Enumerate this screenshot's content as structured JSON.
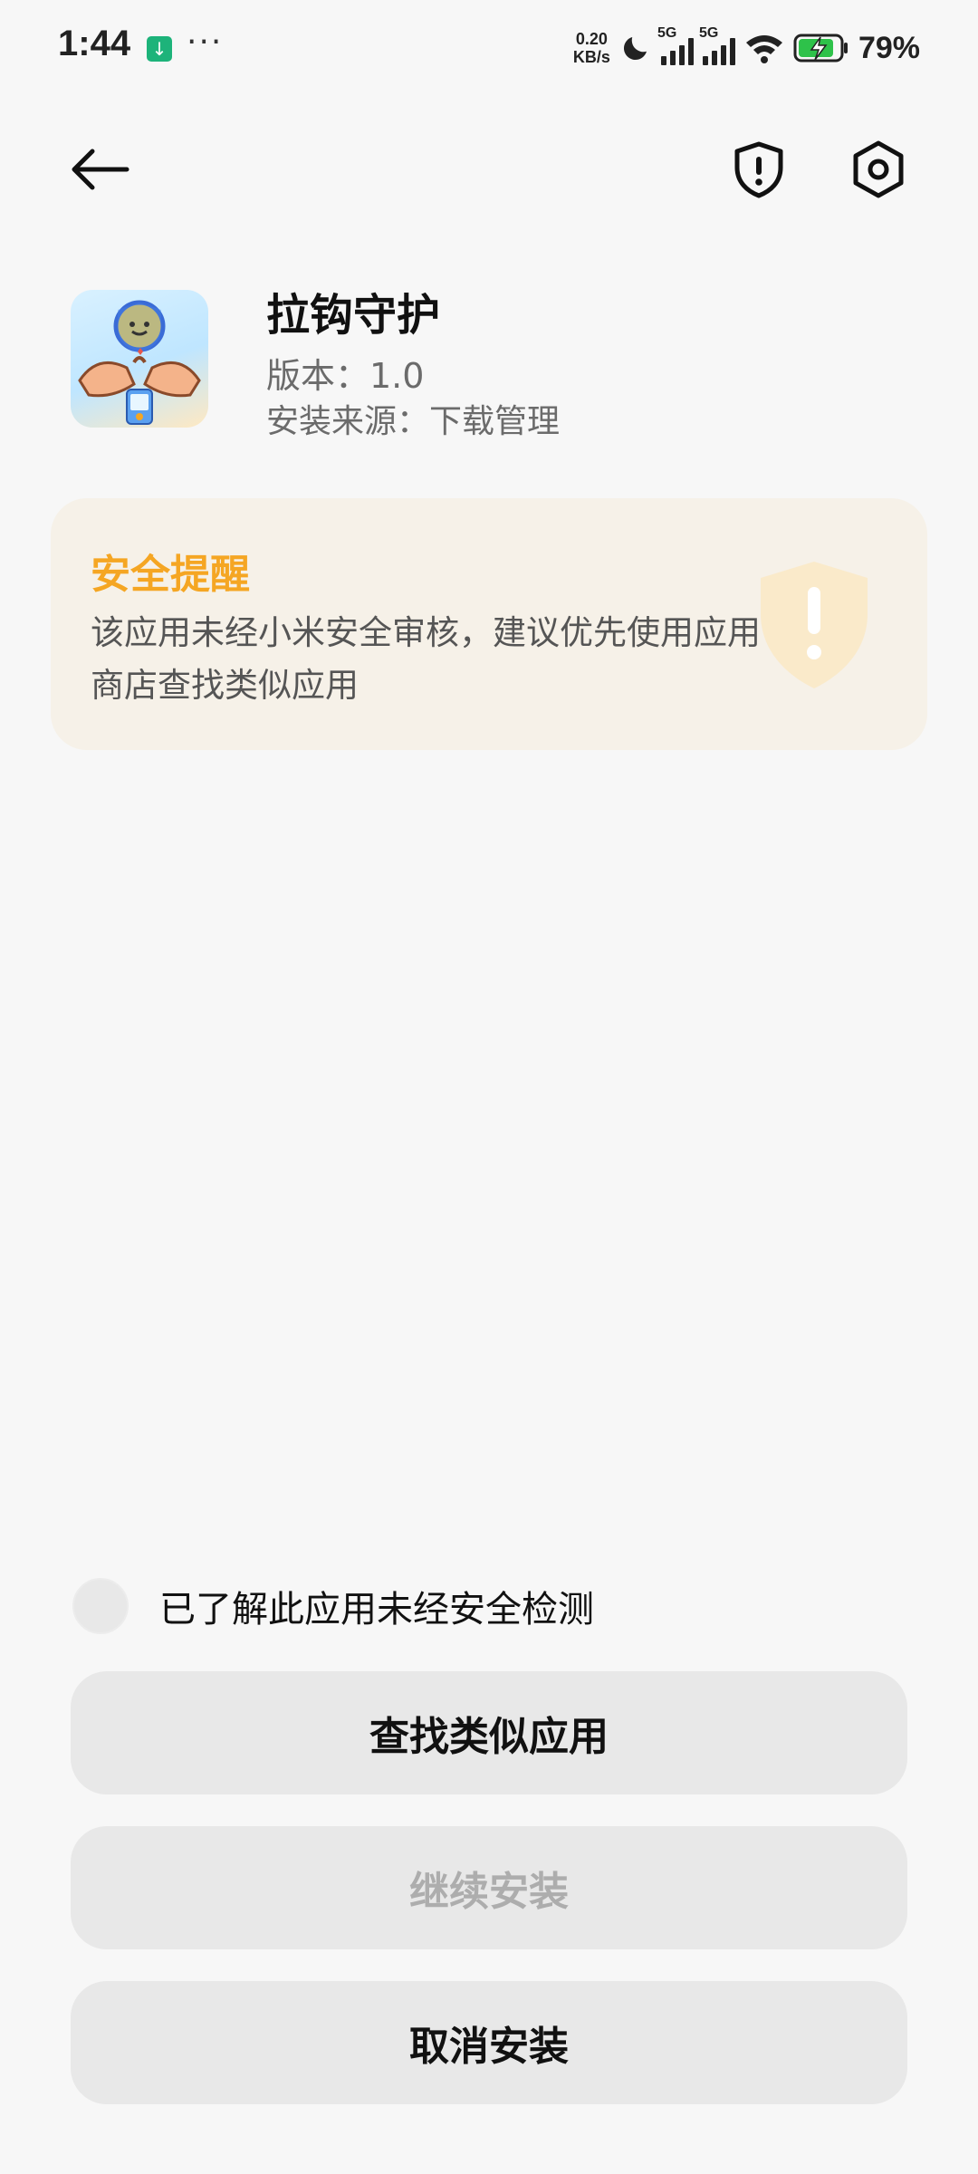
{
  "status_bar": {
    "time": "1:44",
    "notification_icon": "download-icon",
    "more": "···",
    "net_speed_value": "0.20",
    "net_speed_unit": "KB/s",
    "sim1_tag": "5G",
    "sim2_tag": "5G",
    "battery_percent": "79%"
  },
  "toolbar": {
    "back_icon": "arrow-left-icon",
    "shield_icon": "shield-alert-icon",
    "settings_icon": "gear-icon"
  },
  "app": {
    "name": "拉钩守护",
    "version": "版本：1.0",
    "source": "安装来源：下载管理"
  },
  "warning": {
    "title": "安全提醒",
    "text": "该应用未经小米安全审核，建议优先使用应用商店查找类似应用",
    "accent_color": "#f5a623",
    "background_color": "#f6f1e8"
  },
  "acknowledge": {
    "label": "已了解此应用未经安全检测",
    "checked": false
  },
  "buttons": {
    "find_similar": "查找类似应用",
    "continue_install": "继续安装",
    "cancel_install": "取消安装"
  }
}
